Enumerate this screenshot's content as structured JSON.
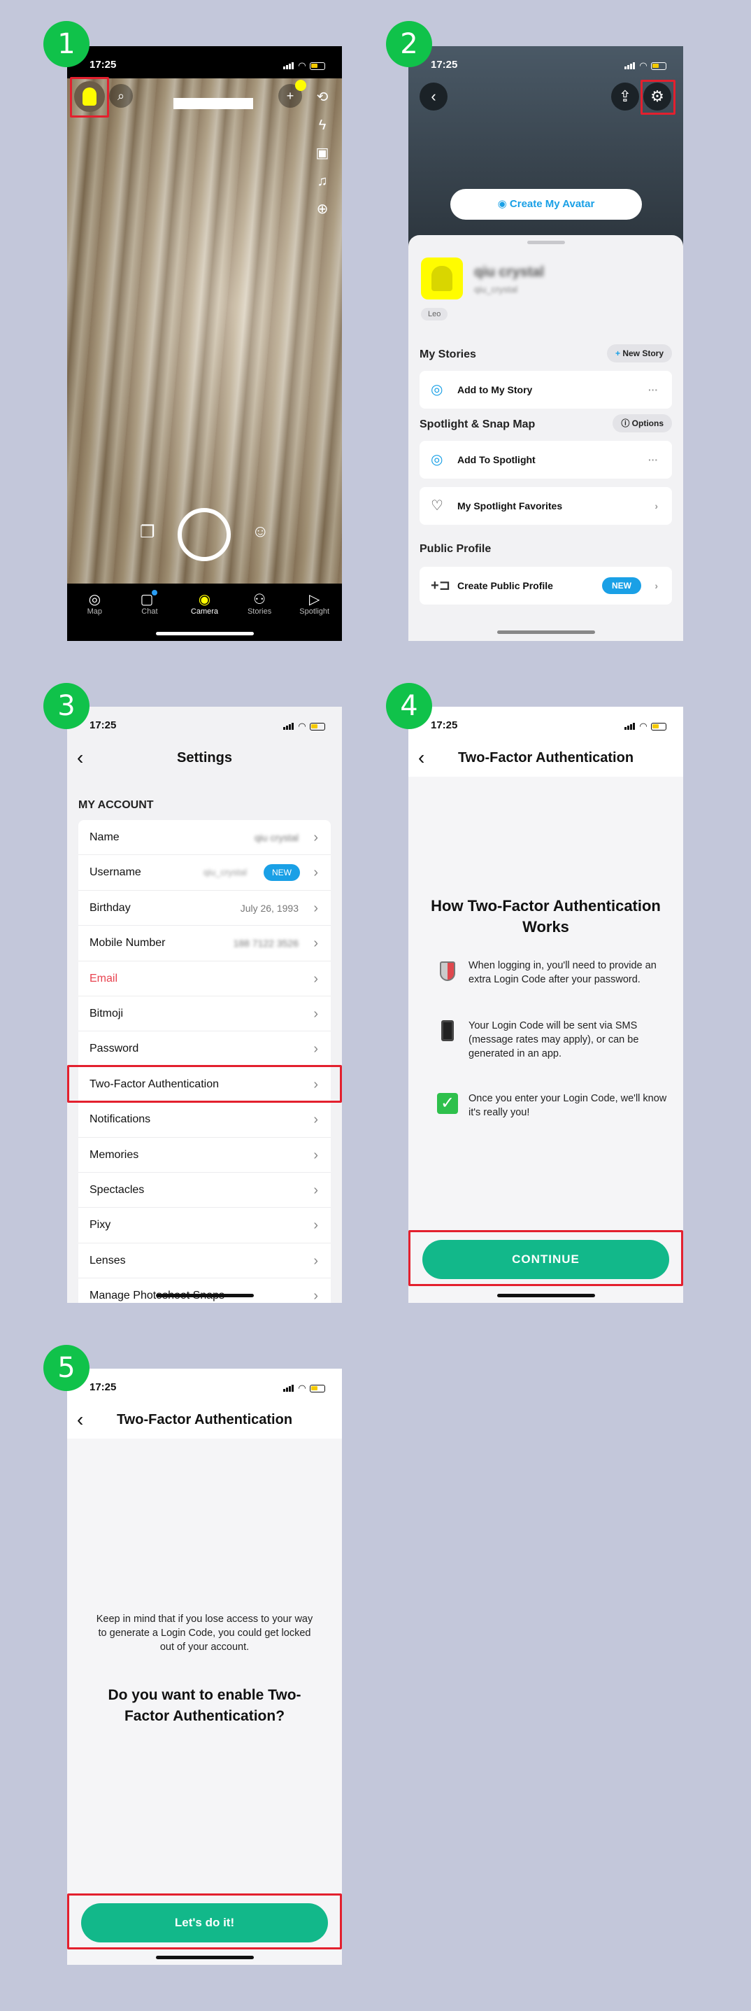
{
  "steps": [
    "1",
    "2",
    "3",
    "4",
    "5"
  ],
  "status_time": "17:25",
  "camera": {
    "nav": [
      {
        "label": "Map",
        "icon": "◎"
      },
      {
        "label": "Chat",
        "icon": "▢"
      },
      {
        "label": "Camera",
        "icon": "◉"
      },
      {
        "label": "Stories",
        "icon": "⚇"
      },
      {
        "label": "Spotlight",
        "icon": "▷"
      }
    ]
  },
  "profile": {
    "create_avatar": "Create My Avatar",
    "display_name": "qiu crystal",
    "username": "qiu_crystal",
    "zodiac": "Leo",
    "my_stories": "My Stories",
    "new_story": "New Story",
    "add_to_story": "Add to My Story",
    "spotlight_map": "Spotlight & Snap Map",
    "options": "Options",
    "add_to_spotlight": "Add To Spotlight",
    "spotlight_favorites": "My Spotlight Favorites",
    "public_profile": "Public Profile",
    "create_public_profile": "Create Public Profile",
    "new_badge": "NEW"
  },
  "settings": {
    "title": "Settings",
    "section": "MY ACCOUNT",
    "rows": [
      {
        "label": "Name",
        "value": "qiu crystal"
      },
      {
        "label": "Username",
        "value": "qiu_crystal",
        "badge": "NEW"
      },
      {
        "label": "Birthday",
        "value": "July 26, 1993"
      },
      {
        "label": "Mobile Number",
        "value": "188 7122 3526"
      },
      {
        "label": "Email",
        "value": ""
      },
      {
        "label": "Bitmoji",
        "value": ""
      },
      {
        "label": "Password",
        "value": ""
      },
      {
        "label": "Two-Factor Authentication",
        "value": ""
      },
      {
        "label": "Notifications",
        "value": ""
      },
      {
        "label": "Memories",
        "value": ""
      },
      {
        "label": "Spectacles",
        "value": ""
      },
      {
        "label": "Pixy",
        "value": ""
      },
      {
        "label": "Lenses",
        "value": ""
      },
      {
        "label": "Manage Photoshoot Snaps",
        "value": ""
      }
    ]
  },
  "twofa": {
    "header": "Two-Factor Authentication",
    "title": "How Two-Factor Authentication Works",
    "items": [
      "When logging in, you'll need to provide an extra Login Code after your password.",
      "Your Login Code will be sent via SMS (message rates may apply), or can be generated in an app.",
      "Once you enter your Login Code, we'll know it's really you!"
    ],
    "continue": "CONTINUE"
  },
  "enable": {
    "header": "Two-Factor Authentication",
    "note": "Keep in mind that if you lose access to your way to generate a Login Code, you could get locked out of your account.",
    "question": "Do you want to enable Two-Factor Authentication?",
    "cta": "Let's do it!"
  },
  "colors": {
    "step_badge": "#10c24a",
    "highlight": "#e3202e",
    "cta": "#12b88a",
    "accent_blue": "#1aa0e6",
    "snap_yellow": "#fffc00"
  }
}
